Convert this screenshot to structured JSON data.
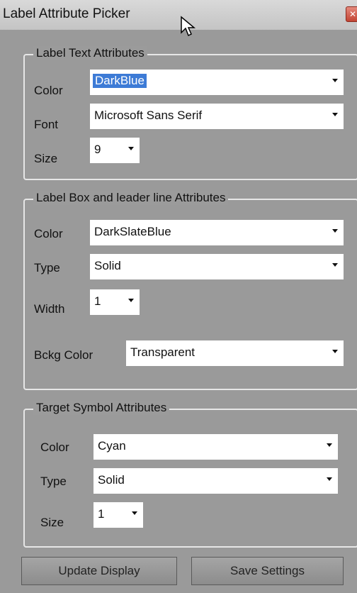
{
  "window": {
    "title": "Label Attribute Picker"
  },
  "label_text": {
    "legend": "Label Text Attributes",
    "color_label": "Color",
    "color_value": "DarkBlue",
    "font_label": "Font",
    "font_value": "Microsoft Sans Serif",
    "size_label": "Size",
    "size_value": "9"
  },
  "label_box": {
    "legend": "Label Box and leader line Attributes",
    "color_label": "Color",
    "color_value": "DarkSlateBlue",
    "type_label": "Type",
    "type_value": "Solid",
    "width_label": "Width",
    "width_value": "1",
    "bckg_label": "Bckg Color",
    "bckg_value": "Transparent"
  },
  "target_symbol": {
    "legend": "Target Symbol Attributes",
    "color_label": "Color",
    "color_value": "Cyan",
    "type_label": "Type",
    "type_value": "Solid",
    "size_label": "Size",
    "size_value": "1"
  },
  "buttons": {
    "update": "Update Display",
    "save": "Save Settings"
  },
  "colors": {
    "background": "#9b9b9b",
    "selection": "#3d7bd6"
  },
  "icons": {
    "cursor": "arrow-pointer-icon",
    "close": "close-icon",
    "dropdown": "chevron-down-icon"
  }
}
